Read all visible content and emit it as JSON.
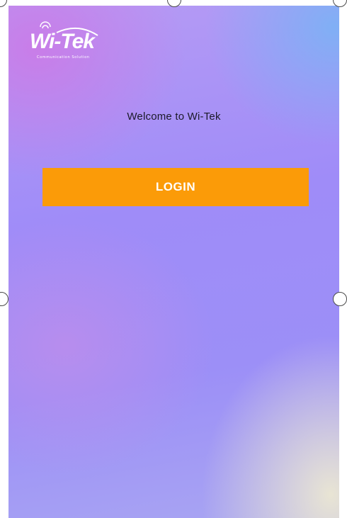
{
  "app": {
    "logo_text": "Wi-Tek",
    "logo_tagline": "Communication Solution",
    "welcome_text": "Welcome to Wi-Tek",
    "login_label": "LOGIN"
  },
  "colors": {
    "login_button": "#fb9b08",
    "login_text": "#ffffff",
    "welcome_text": "#1c1a2a"
  }
}
